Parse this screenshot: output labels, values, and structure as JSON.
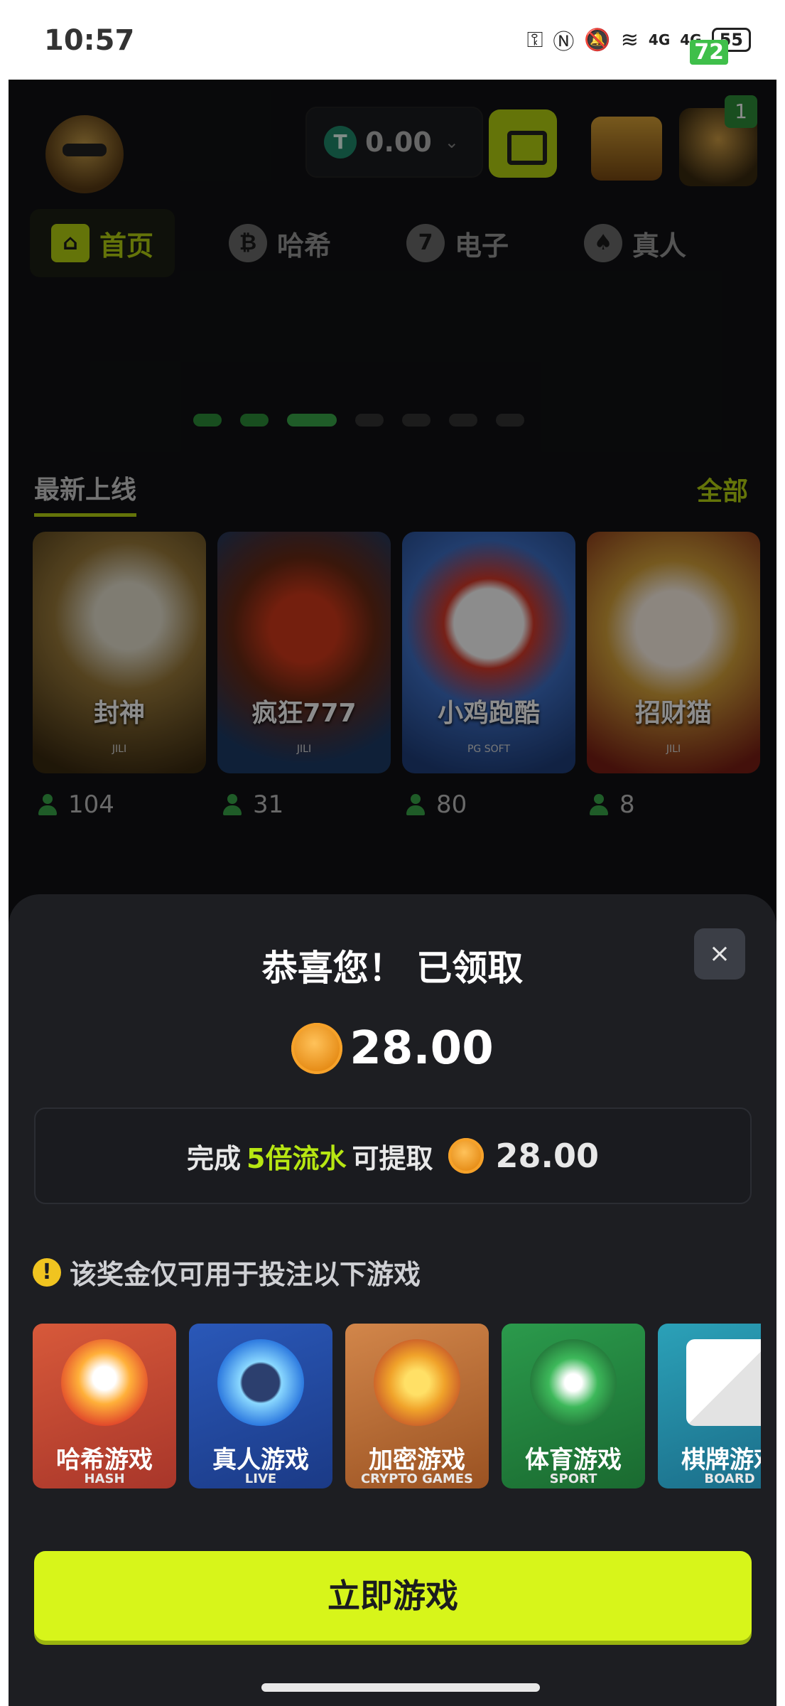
{
  "status_bar": {
    "time": "10:57",
    "battery": "55",
    "signal_1": "4G",
    "signal_2": "4G",
    "badge": "72"
  },
  "header": {
    "balance": "0.00",
    "currency_icon": "T",
    "notification_count": "1"
  },
  "tabs": [
    {
      "label": "首页",
      "icon": "home-icon",
      "active": true
    },
    {
      "label": "哈希",
      "icon": "bitcoin-icon",
      "active": false
    },
    {
      "label": "电子",
      "icon": "777-icon",
      "active": false
    },
    {
      "label": "真人",
      "icon": "cards-icon",
      "active": false
    }
  ],
  "latest": {
    "title": "最新上线",
    "see_all": "全部",
    "games": [
      {
        "name": "封神",
        "provider": "JILI",
        "players": "104"
      },
      {
        "name": "疯狂777",
        "provider": "JILI",
        "players": "31"
      },
      {
        "name": "小鸡跑酷",
        "provider": "PG SOFT",
        "players": "80"
      },
      {
        "name": "招财猫",
        "provider": "JILI",
        "players": "8"
      }
    ]
  },
  "modal": {
    "title": "恭喜您！ 已领取",
    "reward_amount": "28.00",
    "wager_prefix": "完成",
    "wager_highlight": "5倍流水",
    "wager_suffix": "可提取",
    "wager_amount": "28.00",
    "notice": "该奖金仅可用于投注以下游戏",
    "close_glyph": "×",
    "categories": [
      {
        "cn": "哈希游戏",
        "en": "HASH"
      },
      {
        "cn": "真人游戏",
        "en": "LIVE"
      },
      {
        "cn": "加密游戏",
        "en": "CRYPTO GAMES"
      },
      {
        "cn": "体育游戏",
        "en": "SPORT"
      },
      {
        "cn": "棋牌游戏",
        "en": "BOARD"
      }
    ],
    "play_button": "立即游戏"
  },
  "colors": {
    "accent": "#b7d312",
    "button": "#d7f51a",
    "sheet": "#1d1e22"
  }
}
